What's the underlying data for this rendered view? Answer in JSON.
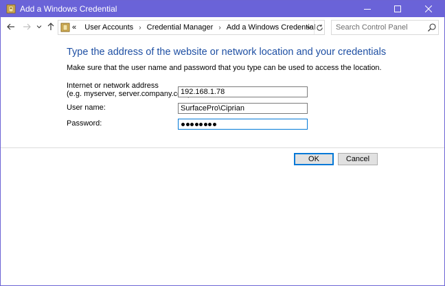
{
  "window": {
    "title": "Add a Windows Credential",
    "controls": {
      "minimize_icon": "minimize-icon",
      "maximize_icon": "maximize-icon",
      "close_icon": "close-icon"
    }
  },
  "nav": {
    "back_icon": "back-arrow-icon",
    "forward_icon": "forward-arrow-icon",
    "recent_icon": "chevron-down-icon",
    "up_icon": "up-arrow-icon",
    "breadcrumb": {
      "overflow": "«",
      "items": [
        "User Accounts",
        "Credential Manager",
        "Add a Windows Credential"
      ],
      "separator": "›"
    },
    "refresh_icon": "refresh-icon",
    "search": {
      "placeholder": "Search Control Panel",
      "value": ""
    }
  },
  "main": {
    "heading": "Type the address of the website or network location and your credentials",
    "description": "Make sure that the user name and password that you type can be used to access the location.",
    "fields": {
      "address": {
        "label_line1": "Internet or network address",
        "label_line2": "(e.g. myserver, server.company.com):",
        "value": "192.168.1.78"
      },
      "username": {
        "label": "User name:",
        "value": "SurfacePro\\Ciprian"
      },
      "password": {
        "label": "Password:",
        "masked_length": 8
      }
    }
  },
  "buttons": {
    "ok": "OK",
    "cancel": "Cancel"
  },
  "colors": {
    "titlebar": "#6a63d8",
    "heading": "#1e4fa3",
    "focus": "#0078d7"
  }
}
